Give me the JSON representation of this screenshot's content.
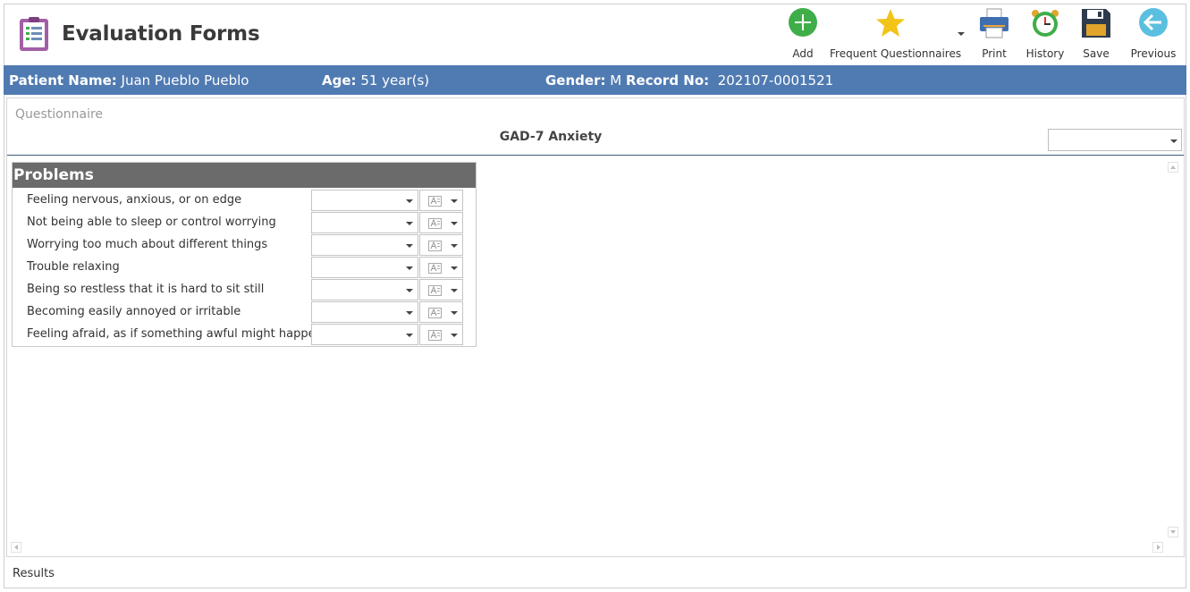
{
  "app": {
    "title": "Evaluation Forms",
    "logo_icon": "clipboard-icon"
  },
  "toolbar": {
    "add": {
      "label": "Add",
      "icon": "plus-circle-icon",
      "color": "#3fae49"
    },
    "frequent": {
      "label": "Frequent Questionnaires",
      "icon": "star-icon",
      "color": "#f2c418"
    },
    "print": {
      "label": "Print",
      "icon": "printer-icon"
    },
    "history": {
      "label": "History",
      "icon": "alarm-clock-icon"
    },
    "save": {
      "label": "Save",
      "icon": "floppy-disk-icon"
    },
    "previous": {
      "label": "Previous",
      "icon": "arrow-left-circle-icon",
      "color": "#5bbfe0"
    }
  },
  "patient": {
    "name_label": "Patient Name:",
    "name_value": "Juan Pueblo Pueblo",
    "age_label": "Age:",
    "age_value": "51 year(s)",
    "gender_label": "Gender:",
    "gender_value": "M",
    "record_label": "Record No:",
    "record_value": "202107-0001521",
    "bar_color": "#507bb2"
  },
  "questionnaire": {
    "label": "Questionnaire",
    "title": "GAD-7 Anxiety",
    "select_value": ""
  },
  "problems": {
    "header": "Problems",
    "items": [
      {
        "text": "Feeling nervous, anxious, or on edge",
        "answer": ""
      },
      {
        "text": "Not being able to sleep or control worrying",
        "answer": ""
      },
      {
        "text": "Worrying too much about different things",
        "answer": ""
      },
      {
        "text": "Trouble relaxing",
        "answer": ""
      },
      {
        "text": "Being so restless that it is hard to sit still",
        "answer": ""
      },
      {
        "text": "Becoming easily annoyed or irritable",
        "answer": ""
      },
      {
        "text": "Feeling afraid, as if something awful might happen",
        "answer": ""
      }
    ]
  },
  "footer": {
    "results_label": "Results"
  }
}
